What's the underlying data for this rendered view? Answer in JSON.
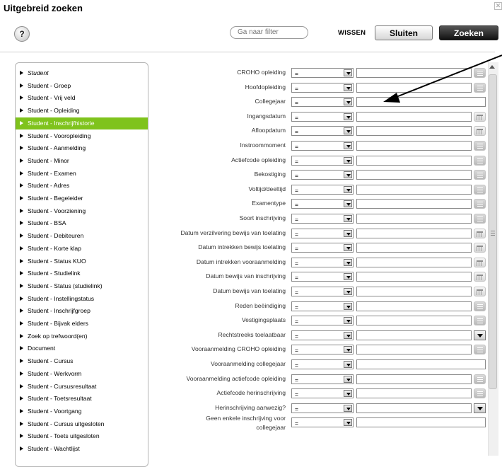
{
  "dialog": {
    "title": "Uitgebreid zoeken",
    "close_glyph": "✕",
    "help_label": "?",
    "filter_placeholder": "Ga naar filter",
    "wissen_label": "WISSEN",
    "sluiten_label": "Sluiten",
    "zoeken_label": "Zoeken"
  },
  "nav": {
    "active_color": "#7fc31c",
    "items": [
      {
        "label": "Student",
        "italic": true
      },
      {
        "label": "Student - Groep"
      },
      {
        "label": "Student - Vrij veld"
      },
      {
        "label": "Student - Opleiding"
      },
      {
        "label": "Student - Inschrijfhistorie",
        "active": true
      },
      {
        "label": "Student - Vooropleiding"
      },
      {
        "label": "Student - Aanmelding"
      },
      {
        "label": "Student - Minor"
      },
      {
        "label": "Student - Examen"
      },
      {
        "label": "Student - Adres"
      },
      {
        "label": "Student - Begeleider"
      },
      {
        "label": "Student - Voorziening"
      },
      {
        "label": "Student - BSA"
      },
      {
        "label": "Student - Debiteuren"
      },
      {
        "label": "Student - Korte klap"
      },
      {
        "label": "Student - Status KUO"
      },
      {
        "label": "Student - Studielink"
      },
      {
        "label": "Student - Status (studielink)"
      },
      {
        "label": "Student - Instellingstatus"
      },
      {
        "label": "Student - Inschrijfgroep"
      },
      {
        "label": "Student - Bijvak elders"
      },
      {
        "label": "Zoek op trefwoord(en)"
      },
      {
        "label": "Document"
      },
      {
        "label": "Student - Cursus"
      },
      {
        "label": "Student - Werkvorm"
      },
      {
        "label": "Student - Cursusresultaat"
      },
      {
        "label": "Student - Toetsresultaat"
      },
      {
        "label": "Student - Voortgang"
      },
      {
        "label": "Student - Cursus uitgesloten"
      },
      {
        "label": "Student - Toets uitgesloten"
      },
      {
        "label": "Student - Wachtlijst"
      }
    ]
  },
  "fields": [
    {
      "label": "CROHO opleiding",
      "operator": "=",
      "icon": "list-icon"
    },
    {
      "label": "Hoofdopleiding",
      "operator": "=",
      "icon": "list-icon"
    },
    {
      "label": "Collegejaar",
      "operator": "=",
      "icon": "none"
    },
    {
      "label": "Ingangsdatum",
      "operator": "=",
      "icon": "calendar-icon"
    },
    {
      "label": "Afloopdatum",
      "operator": "=",
      "icon": "calendar-icon"
    },
    {
      "label": "Instroommoment",
      "operator": "=",
      "icon": "list-icon"
    },
    {
      "label": "Actiefcode opleiding",
      "operator": "=",
      "icon": "list-icon"
    },
    {
      "label": "Bekostiging",
      "operator": "=",
      "icon": "list-icon"
    },
    {
      "label": "Voltijd/deeltijd",
      "operator": "=",
      "icon": "list-icon"
    },
    {
      "label": "Examentype",
      "operator": "=",
      "icon": "list-icon"
    },
    {
      "label": "Soort inschrijving",
      "operator": "=",
      "icon": "list-icon"
    },
    {
      "label": "Datum verzilvering bewijs van toelating",
      "operator": "=",
      "icon": "calendar-icon"
    },
    {
      "label": "Datum intrekken bewijs toelating",
      "operator": "=",
      "icon": "calendar-icon"
    },
    {
      "label": "Datum intrekken vooraanmelding",
      "operator": "=",
      "icon": "calendar-icon"
    },
    {
      "label": "Datum bewijs van inschrijving",
      "operator": "=",
      "icon": "calendar-icon"
    },
    {
      "label": "Datum bewijs van toelating",
      "operator": "=",
      "icon": "calendar-icon"
    },
    {
      "label": "Reden beëindiging",
      "operator": "=",
      "icon": "list-icon"
    },
    {
      "label": "Vestigingsplaats",
      "operator": "=",
      "icon": "list-icon"
    },
    {
      "label": "Rechtstreeks toelaatbaar",
      "operator": "=",
      "icon": "dropdown-icon"
    },
    {
      "label": "Vooraanmelding CROHO opleiding",
      "operator": "=",
      "icon": "list-icon"
    },
    {
      "label": "Vooraanmelding collegejaar",
      "operator": "=",
      "icon": "none"
    },
    {
      "label": "Vooraanmelding actiefcode opleiding",
      "operator": "=",
      "icon": "list-icon"
    },
    {
      "label": "Actiefcode herinschrijving",
      "operator": "=",
      "icon": "list-icon"
    },
    {
      "label": "Herinschrijving aanwezig?",
      "operator": "=",
      "icon": "dropdown-icon"
    },
    {
      "label": "Geen enkele inschrijving voor collegejaar",
      "operator": "=",
      "icon": "none"
    }
  ]
}
